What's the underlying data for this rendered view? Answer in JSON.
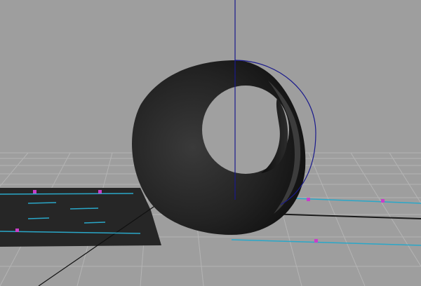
{
  "viewport": {
    "background_color": "#9e9e9e",
    "grid_color": "#b4b4b4",
    "grid_major_color": "#000000",
    "axis_color": "#1a1a8c",
    "curve_color": "#2aa7c8",
    "cv_marker_color": "#c93ec9",
    "object_color": "#1e1e1e",
    "shadow_color": "#262626"
  },
  "scene_objects": [
    {
      "name": "tube-geometry",
      "type": "cylinder",
      "shading": "smooth",
      "selected": false
    },
    {
      "name": "shadow-plane",
      "type": "plane",
      "selected": false
    },
    {
      "name": "nurbs-curves",
      "type": "curve",
      "count": 4
    },
    {
      "name": "manipulator-circle",
      "type": "rotate-ring"
    }
  ]
}
